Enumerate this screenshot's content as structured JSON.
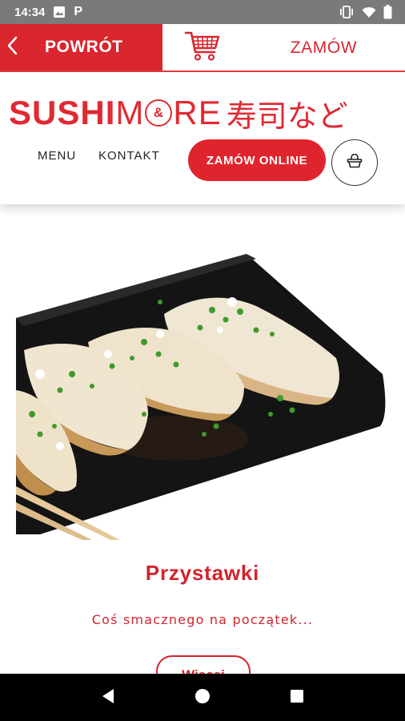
{
  "status_bar": {
    "time": "14:34",
    "icons": [
      "image-icon",
      "parking-p-icon",
      "vibrate-icon",
      "wifi-icon",
      "battery-icon"
    ],
    "p_glyph": "P"
  },
  "topbar": {
    "back_label": "POWRÓT",
    "cart_icon": "shopping-cart-icon",
    "order_label": "ZAMÓW"
  },
  "site_header": {
    "logo": {
      "part1": "SUSHI",
      "part2_a": "M",
      "amp": "&",
      "part2_b": "RE",
      "jp": "寿司など"
    },
    "nav": {
      "menu": "MENU",
      "contact": "KONTAKT"
    },
    "order_online_label": "ZAMÓW ONLINE",
    "basket_icon": "basket-icon"
  },
  "category": {
    "title": "Przystawki",
    "subtitle": "Coś smacznego na początek...",
    "more_label": "Więcej"
  },
  "colors": {
    "brand_red": "#e0242e",
    "status_bar": "#7a7a7a",
    "nav_bar": "#000000"
  }
}
